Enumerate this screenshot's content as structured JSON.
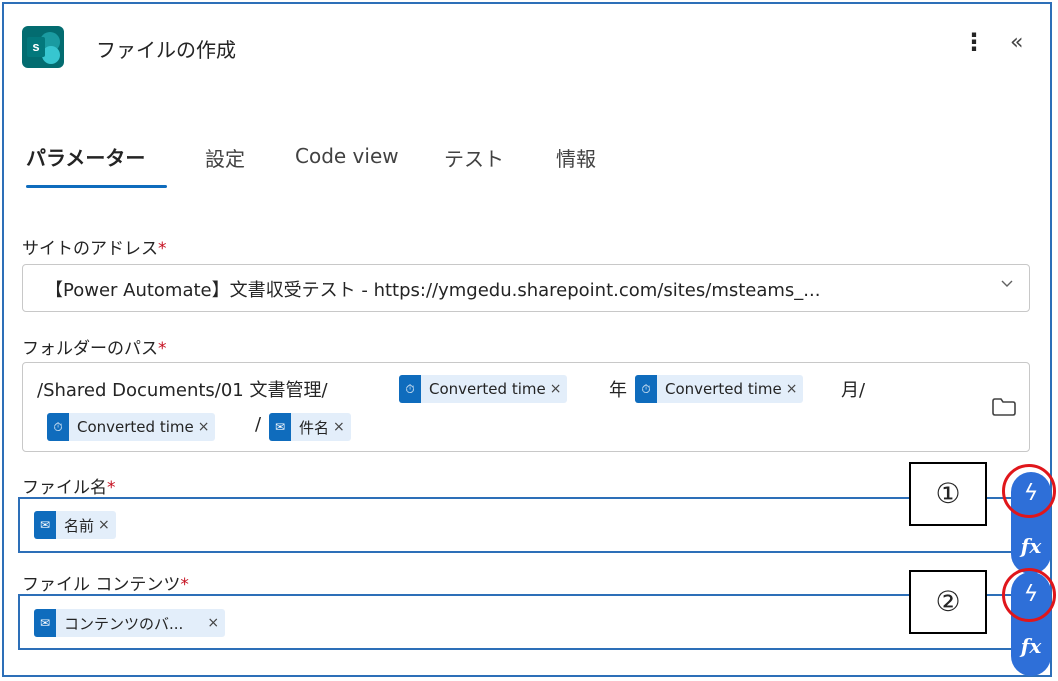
{
  "header": {
    "title": "ファイルの作成",
    "app_icon_letter": "s",
    "more_icon": "⋮",
    "collapse_icon": "«"
  },
  "tabs": [
    {
      "label": "パラメーター",
      "active": true
    },
    {
      "label": "設定",
      "active": false
    },
    {
      "label": "Code view",
      "active": false
    },
    {
      "label": "テスト",
      "active": false
    },
    {
      "label": "情報",
      "active": false
    }
  ],
  "fields": {
    "site": {
      "label": "サイトのアドレス",
      "required": "*",
      "value": "【Power Automate】文書収受テスト - https://ymgedu.sharepoint.com/sites/msteams_..."
    },
    "folder": {
      "label": "フォルダーのパス",
      "required": "*",
      "text1": "/Shared Documents/01 文書管理/",
      "token1": "Converted time",
      "text2": "年",
      "token2": "Converted time",
      "text3": "月/",
      "token3": "Converted time",
      "text4": "/",
      "token4": "件名"
    },
    "filename": {
      "label": "ファイル名",
      "required": "*",
      "token": "名前"
    },
    "content": {
      "label": "ファイル コンテンツ",
      "required": "*",
      "token": "コンテンツのバ..."
    }
  },
  "token_remove": "×",
  "annotations": {
    "marker1": "①",
    "marker2": "②"
  },
  "side_buttons": {
    "dynamic_icon": "ϟ",
    "fx_label": "fx"
  },
  "colors": {
    "accent": "#0f6cbd",
    "token_bg": "#e3eefa",
    "focus_border": "#2d6fb8",
    "highlight_ring": "#e0161b",
    "side_pill": "#2e6fd8"
  }
}
